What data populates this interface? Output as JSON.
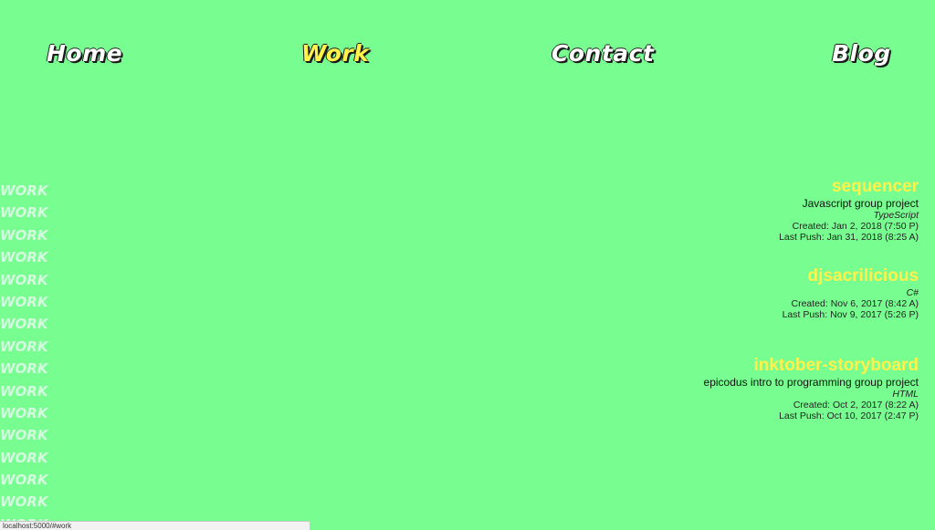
{
  "nav": {
    "home": "Home",
    "work": "Work",
    "contact": "Contact",
    "blog": "Blog",
    "active": "work"
  },
  "watermark": {
    "word": "WORK",
    "repeat": 16
  },
  "repos": [
    {
      "name": "sequencer",
      "description": "Javascript group project",
      "language": "TypeScript",
      "created": "Created: Jan 2, 2018 (7:50 P)",
      "last_push": "Last Push: Jan 31, 2018 (8:25 A)"
    },
    {
      "name": "djsacrilicious",
      "description": "",
      "language": "C#",
      "created": "Created: Nov 6, 2017 (8:42 A)",
      "last_push": "Last Push: Nov 9, 2017 (5:26 P)"
    },
    {
      "name": "inktober-storyboard",
      "description": "epicodus intro to programming group project",
      "language": "HTML",
      "created": "Created: Oct 2, 2017 (8:22 A)",
      "last_push": "Last Push: Oct 10, 2017 (2:47 P)"
    }
  ],
  "status_bar": {
    "url": "localhost:5000/#work"
  },
  "colors": {
    "background": "#78fd90",
    "accent": "#fff24a",
    "watermark": "#d4fbe0"
  }
}
